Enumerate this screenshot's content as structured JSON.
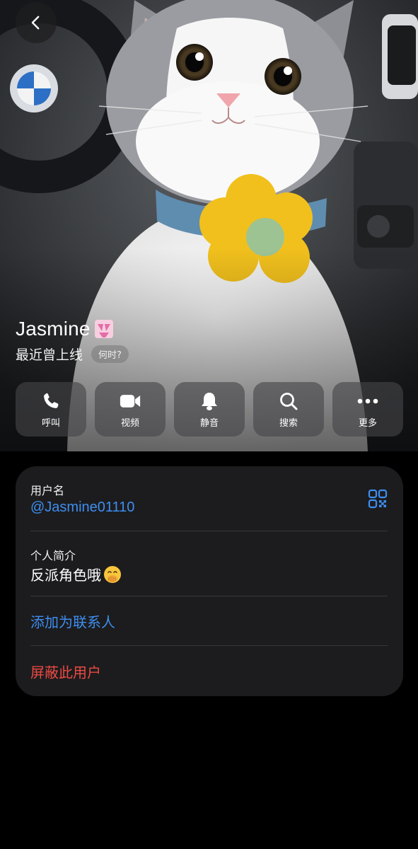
{
  "header": {
    "name": "Jasmine",
    "status": "最近曾上线",
    "when_label": "何时?"
  },
  "actions": [
    {
      "icon": "phone-icon",
      "label": "呼叫"
    },
    {
      "icon": "video-icon",
      "label": "视频"
    },
    {
      "icon": "bell-icon",
      "label": "静音"
    },
    {
      "icon": "search-icon",
      "label": "搜索"
    },
    {
      "icon": "more-icon",
      "label": "更多"
    }
  ],
  "info": {
    "username_label": "用户名",
    "username": "@Jasmine01110",
    "bio_label": "个人简介",
    "bio": "反派角色哦",
    "add_contact": "添加为联系人",
    "block_user": "屏蔽此用户"
  },
  "colors": {
    "link": "#3e8ef0",
    "danger": "#ec4a43",
    "card_bg": "#1c1c1e",
    "page_bg": "#000000"
  }
}
